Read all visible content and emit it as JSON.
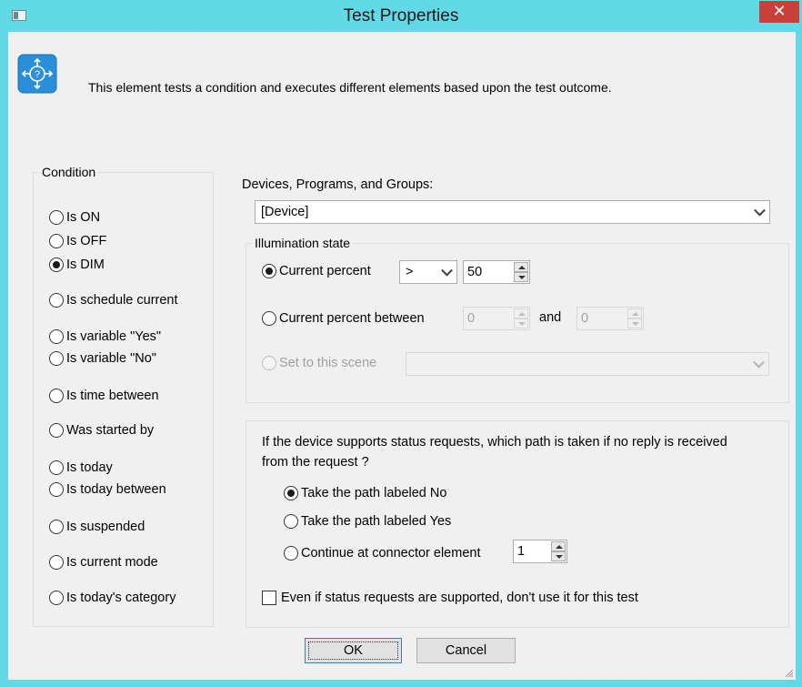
{
  "window": {
    "title": "Test Properties",
    "close_glyph": "✕",
    "icon": "window-icon"
  },
  "info": {
    "text": "This element tests a condition and executes different elements based upon the test outcome.",
    "icon": "test-element-icon",
    "icon_color": "#2a8fd8"
  },
  "condition": {
    "legend": "Condition",
    "options": [
      {
        "label": "Is ON",
        "checked": false
      },
      {
        "label": "Is OFF",
        "checked": false
      },
      {
        "label": "Is DIM",
        "checked": true
      },
      {
        "label": "Is schedule current",
        "checked": false
      },
      {
        "label": "Is variable \"Yes\"",
        "checked": false
      },
      {
        "label": "Is variable \"No\"",
        "checked": false
      },
      {
        "label": "Is time between",
        "checked": false
      },
      {
        "label": "Was started by",
        "checked": false
      },
      {
        "label": "Is today",
        "checked": false
      },
      {
        "label": "Is today between",
        "checked": false
      },
      {
        "label": "Is suspended",
        "checked": false
      },
      {
        "label": "Is current mode",
        "checked": false
      },
      {
        "label": "Is today's category",
        "checked": false
      }
    ]
  },
  "devices": {
    "label": "Devices, Programs, and Groups:",
    "selected": "[Device]"
  },
  "illumination": {
    "legend": "Illumination state",
    "current_percent_label": "Current percent",
    "operator": ">",
    "percent_value": "50",
    "between_label": "Current percent between",
    "between_from": "0",
    "and_label": "and",
    "between_to": "0",
    "scene_label": "Set to this scene",
    "scene_selected": ""
  },
  "status": {
    "question": "If the device supports status requests, which path is taken if no reply is received from the request ?",
    "options": [
      {
        "label": "Take the path labeled No",
        "checked": true
      },
      {
        "label": "Take the path labeled Yes",
        "checked": false
      },
      {
        "label": "Continue at connector element",
        "checked": false
      }
    ],
    "connector_value": "1",
    "ignore_label": "Even if status requests are supported, don't use it for this test",
    "ignore_checked": false
  },
  "buttons": {
    "ok": "OK",
    "cancel": "Cancel"
  },
  "colors": {
    "titlebar": "#62d9e6",
    "close": "#c7403a",
    "dialog_bg": "#f0f0f0"
  }
}
